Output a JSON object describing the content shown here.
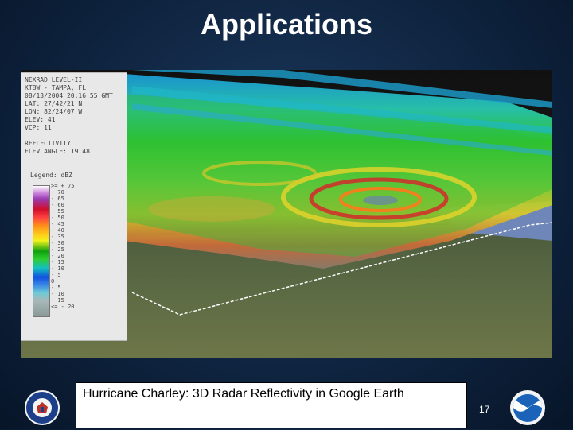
{
  "slide": {
    "title": "Applications",
    "caption": "Hurricane Charley: 3D Radar Reflectivity in Google Earth",
    "page_number": "17"
  },
  "radar": {
    "meta": [
      "NEXRAD LEVEL-II",
      "KTBW - TAMPA, FL",
      "08/13/2004 20:16:55 GMT",
      "LAT: 27/42/21 N",
      "LON: 82/24/07 W",
      "ELEV: 41",
      "VCP: 11",
      "",
      "REFLECTIVITY",
      "ELEV ANGLE: 19.48"
    ],
    "legend_label": "Legend: dBZ",
    "legend_ticks": [
      ">= + 75",
      "- 70",
      "- 65",
      "- 60",
      "- 55",
      "- 50",
      "- 45",
      "- 40",
      "- 35",
      "- 30",
      "- 25",
      "- 20",
      "- 15",
      "- 10",
      "- 5",
      "0",
      "- 5",
      "- 10",
      "- 15",
      "<= - 20"
    ],
    "colors": {
      "background": "#0f2440",
      "green": "#2ecc2e",
      "yellow": "#f2f21a",
      "red": "#d10e2a",
      "blue": "#1050e0"
    }
  },
  "logos": {
    "left": "Department of Commerce seal",
    "right": "NOAA logo"
  }
}
